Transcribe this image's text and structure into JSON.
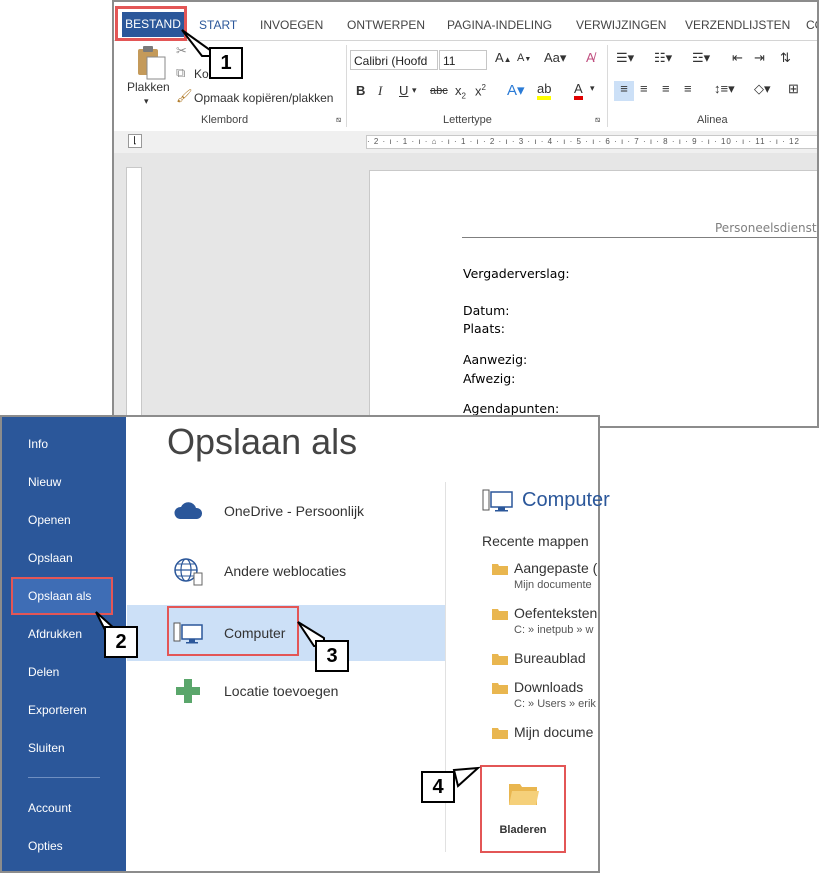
{
  "word": {
    "tabs": [
      "BESTAND",
      "START",
      "INVOEGEN",
      "ONTWERPEN",
      "PAGINA-INDELING",
      "VERWIJZINGEN",
      "VERZENDLIJSTEN",
      "CO"
    ],
    "clipboard": {
      "paste_label": "Plakken",
      "copy_label": "Ko",
      "format_painter_label": "Opmaak kopiëren/plakken",
      "group_label": "Klembord"
    },
    "font": {
      "font_name": "Calibri (Hoofd",
      "font_size": "11",
      "group_label": "Lettertype"
    },
    "paragraph": {
      "group_label": "Alinea"
    },
    "ruler_text": "· 2 · ı · 1 · ı · ⌂ · ı · 1 · ı · 2 · ı · 3 · ı · 4 · ı · 5 · ı · 6 · ı · 7 · ı · 8 · ı · 9 · ı · 10 · ı · 11 · ı · 12",
    "document": {
      "header": "Personeelsdienst",
      "lines": [
        "Vergaderverslag:",
        "Datum:",
        "Plaats:",
        "Aanwezig:",
        "Afwezig:",
        "Agendapunten:"
      ]
    }
  },
  "backstage": {
    "nav": [
      "Info",
      "Nieuw",
      "Openen",
      "Opslaan",
      "Opslaan als",
      "Afdrukken",
      "Delen",
      "Exporteren",
      "Sluiten"
    ],
    "nav_bottom": [
      "Account",
      "Opties"
    ],
    "active_nav": "Opslaan als",
    "title": "Opslaan als",
    "places": [
      {
        "label": "OneDrive - Persoonlijk",
        "icon": "cloud-icon"
      },
      {
        "label": "Andere weblocaties",
        "icon": "globe-icon"
      },
      {
        "label": "Computer",
        "icon": "computer-icon"
      },
      {
        "label": "Locatie toevoegen",
        "icon": "plus-icon"
      }
    ],
    "selected_place": "Computer",
    "right": {
      "title": "Computer",
      "recent_heading": "Recente mappen",
      "folders": [
        {
          "name": "Aangepaste (",
          "path": "Mijn documente"
        },
        {
          "name": "Oefenteksten",
          "path": "C: » inetpub » w"
        },
        {
          "name": "Bureaublad",
          "path": ""
        },
        {
          "name": "Downloads",
          "path": "C: » Users » erik s"
        },
        {
          "name": "Mijn docume",
          "path": ""
        }
      ],
      "browse_label": "Bladeren"
    }
  },
  "callouts": [
    "1",
    "2",
    "3",
    "4"
  ],
  "colors": {
    "word_blue": "#2b579a",
    "highlight_red": "#e35656",
    "selected_place_bg": "#cce0f7"
  }
}
